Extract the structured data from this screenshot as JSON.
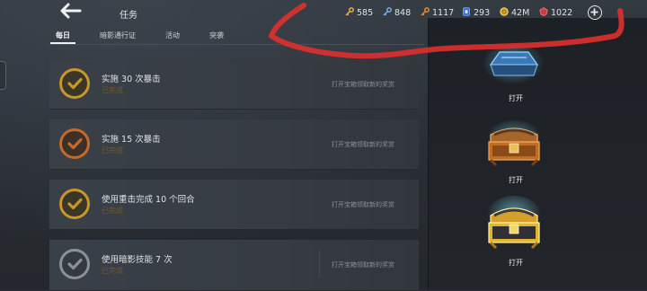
{
  "header": {
    "title": "任务",
    "resources": [
      {
        "icon": "gold-key-icon",
        "value": "585"
      },
      {
        "icon": "blue-key-icon",
        "value": "848"
      },
      {
        "icon": "orange-key-icon",
        "value": "1117"
      },
      {
        "icon": "energy-icon",
        "value": "293"
      },
      {
        "icon": "gold-coin-icon",
        "value": "42M"
      },
      {
        "icon": "ruby-gem-icon",
        "value": "1022"
      }
    ]
  },
  "tabs": [
    {
      "label": "每日",
      "active": true
    },
    {
      "label": "暗影通行证",
      "active": false
    },
    {
      "label": "活动",
      "active": false
    },
    {
      "label": "突袭",
      "active": false
    }
  ],
  "tasks": [
    {
      "name": "实施 30 次暴击",
      "status": "已完成",
      "hint": "打开宝箱领取新的奖赏",
      "badge_color": "#c9962a"
    },
    {
      "name": "实施 15 次暴击",
      "status": "已完成",
      "hint": "打开宝箱领取新的奖赏",
      "badge_color": "#c56a2a"
    },
    {
      "name": "使用重击完成 10 个回合",
      "status": "已完成",
      "hint": "打开宝箱领取新的奖赏",
      "badge_color": "#c9962a"
    },
    {
      "name": "使用暗影技能 7 次",
      "status": "已完成",
      "hint": "打开宝箱领取新的奖赏",
      "badge_color": "#8a9298"
    }
  ],
  "chests": [
    {
      "label": "打开",
      "tier": "blue"
    },
    {
      "label": "打开",
      "tier": "bronze"
    },
    {
      "label": "打开",
      "tier": "gold"
    }
  ],
  "colors": {
    "status_text": "#6f5a2c",
    "scribble": "#e0302e"
  }
}
